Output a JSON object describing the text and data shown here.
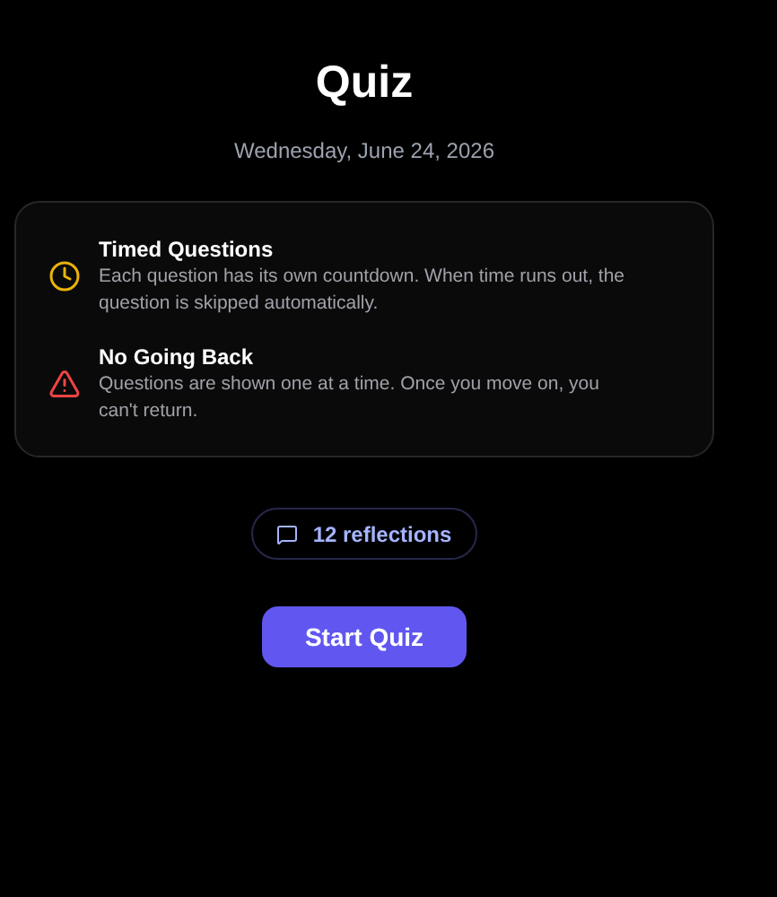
{
  "title": "Quiz",
  "date": "Wednesday, June 24, 2026",
  "rules": [
    {
      "kind": "timer",
      "title": "Timed Questions",
      "text": "Each question has its own countdown. When time runs out, the question is skipped automatically."
    },
    {
      "kind": "warning",
      "title": "No Going Back",
      "text": "Questions are shown one at a time. Once you move on, you can't return."
    }
  ],
  "reflections": "12 reflections",
  "start_button": "Start Quiz"
}
